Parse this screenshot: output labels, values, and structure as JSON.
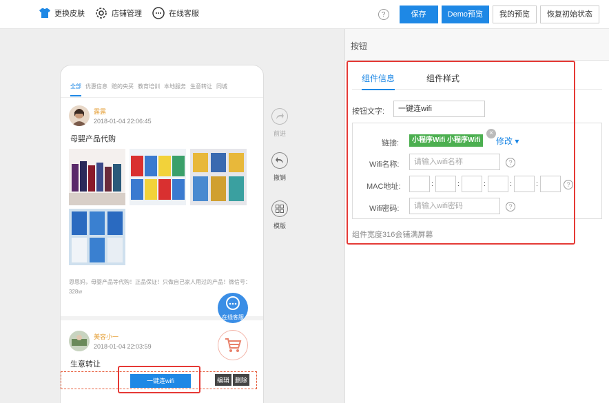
{
  "topbar": {
    "skin_label": "更换皮肤",
    "shop_label": "店铺管理",
    "service_label": "在线客服",
    "help_icon": "?",
    "save_label": "保存",
    "demo_label": "Demo预览",
    "preview_label": "我的预览",
    "reset_label": "恢复初始状态"
  },
  "phone": {
    "tabs": [
      "全部",
      "优惠信息",
      "赔的央买",
      "教育培训",
      "本地服务",
      "生意转让",
      "同城"
    ],
    "post1": {
      "user": "露露",
      "time": "2018-01-04 22:06:45",
      "title": "母婴产品代购",
      "desc": "恩恩妈，母婴产品等代购！正品保证！只做自己家人用过的产品！微信号：328w"
    },
    "post2": {
      "user": "美容小一",
      "time": "2018-01-04 22:03:59",
      "title": "生意转让"
    },
    "float_service_label": "在线客服",
    "wifi_button_label": "一键连wifi",
    "edit_label": "编辑",
    "delete_label": "删除"
  },
  "tools": {
    "forward_label": "前进",
    "undo_label": "撤销",
    "template_label": "模版"
  },
  "panel": {
    "header": "按钮",
    "tabs": [
      "组件信息",
      "组件样式"
    ],
    "button_text_label": "按钮文字:",
    "button_text_value": "一键连wifi",
    "link_label": "链接:",
    "link_tag": "小程序Wifi 小程序Wifi",
    "modify_label": "修改 ▾",
    "wifi_name_label": "Wifi名称:",
    "wifi_name_placeholder": "请输入wifi名称",
    "mac_label": "MAC地址:",
    "wifi_pwd_label": "Wifi密码:",
    "wifi_pwd_placeholder": "请输入wifi密码",
    "note": "组件宽度316会铺满屏幕"
  },
  "colors": {
    "primary": "#1e88e5",
    "highlight": "#e53935",
    "tag_green": "#4caf50"
  }
}
